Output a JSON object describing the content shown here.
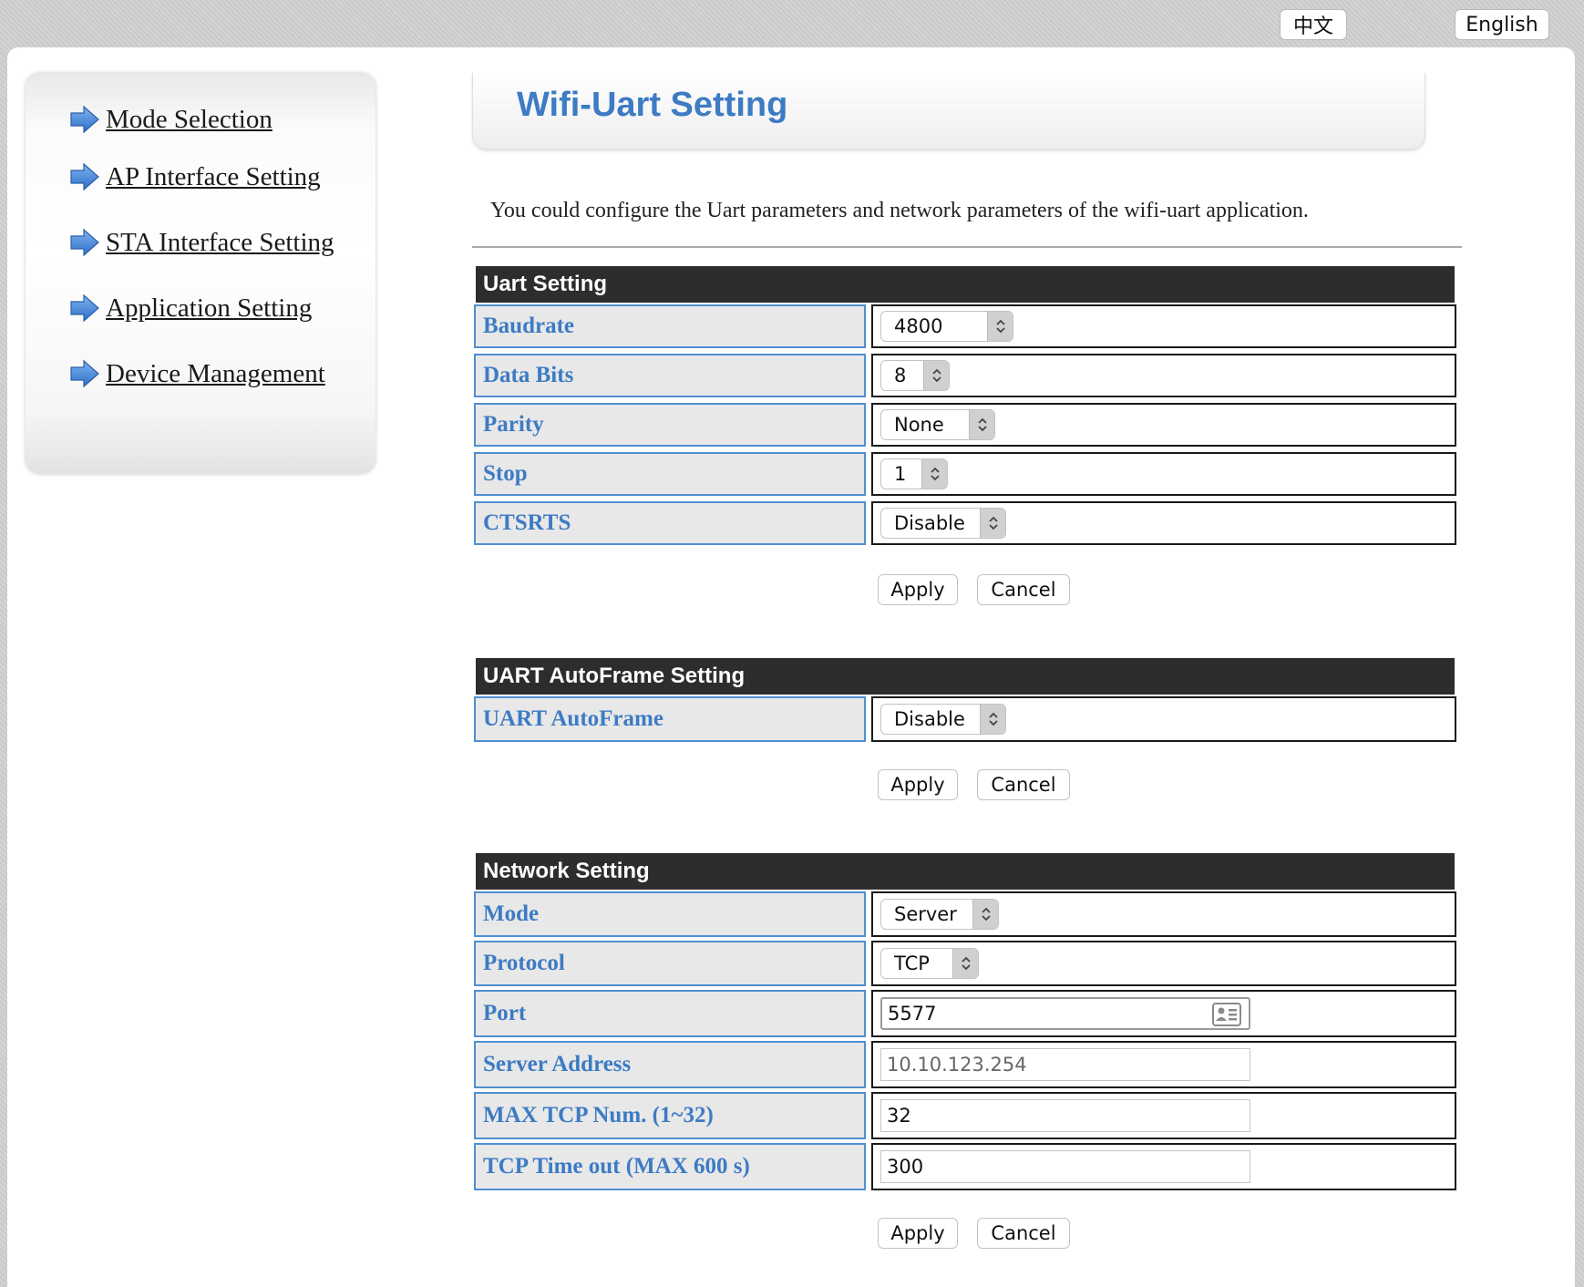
{
  "lang": {
    "zh": "中文",
    "en": "English"
  },
  "sidebar": {
    "items": [
      {
        "label": "Mode Selection",
        "icon": "arrow-right-icon"
      },
      {
        "label": "AP Interface Setting",
        "icon": "arrow-right-icon"
      },
      {
        "label": "STA Interface Setting",
        "icon": "arrow-right-icon"
      },
      {
        "label": "Application Setting",
        "icon": "arrow-right-icon"
      },
      {
        "label": "Device Management",
        "icon": "arrow-right-icon"
      }
    ]
  },
  "header": {
    "title": "Wifi-Uart Setting",
    "description": "You could configure the Uart parameters and network parameters of the wifi-uart application."
  },
  "uart": {
    "title": "Uart Setting",
    "rows": [
      {
        "label": "Baudrate",
        "value": "4800"
      },
      {
        "label": "Data Bits",
        "value": "8"
      },
      {
        "label": "Parity",
        "value": "None"
      },
      {
        "label": "Stop",
        "value": "1"
      },
      {
        "label": "CTSRTS",
        "value": "Disable"
      }
    ],
    "apply": "Apply",
    "cancel": "Cancel"
  },
  "autoframe": {
    "title": "UART AutoFrame Setting",
    "rows": [
      {
        "label": "UART AutoFrame",
        "value": "Disable"
      }
    ],
    "apply": "Apply",
    "cancel": "Cancel"
  },
  "network": {
    "title": "Network Setting",
    "rows": [
      {
        "label": "Mode",
        "value": "Server"
      },
      {
        "label": "Protocol",
        "value": "TCP"
      },
      {
        "label": "Port",
        "value": "5577"
      },
      {
        "label": "Server Address",
        "value": "10.10.123.254"
      },
      {
        "label": "MAX TCP Num. (1~32)",
        "value": "32"
      },
      {
        "label": "TCP Time out (MAX 600 s)",
        "value": "300"
      }
    ],
    "apply": "Apply",
    "cancel": "Cancel"
  },
  "colors": {
    "accent": "#3d7bc4",
    "label_border": "#4f8fd0",
    "section_bar": "#2d2d2d",
    "label_bg": "#e8e8e8"
  }
}
